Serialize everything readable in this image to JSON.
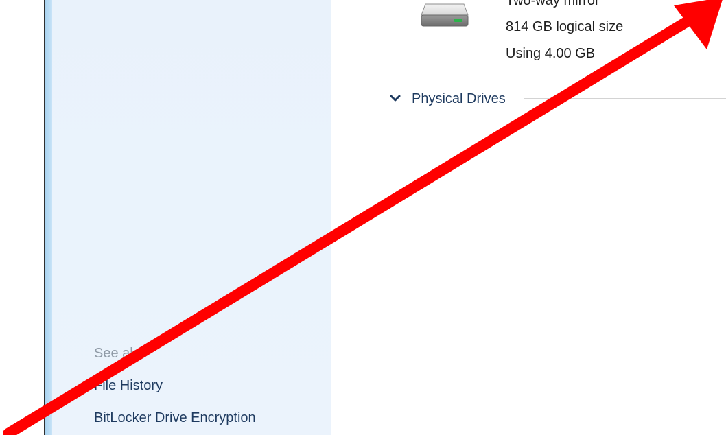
{
  "sidebar": {
    "see_also_label": "See also",
    "links": [
      {
        "label": "File History"
      },
      {
        "label": "BitLocker Drive Encryption"
      }
    ]
  },
  "storage_space": {
    "resiliency": "Two-way mirror",
    "logical_size": "814 GB logical size",
    "usage": "Using 4.00 GB",
    "icon": "hard-drive-icon"
  },
  "physical_drives": {
    "label": "Physical Drives",
    "icon": "chevron-down-icon"
  },
  "annotation": {
    "icon": "red-arrow-icon",
    "color": "#ff0000"
  }
}
